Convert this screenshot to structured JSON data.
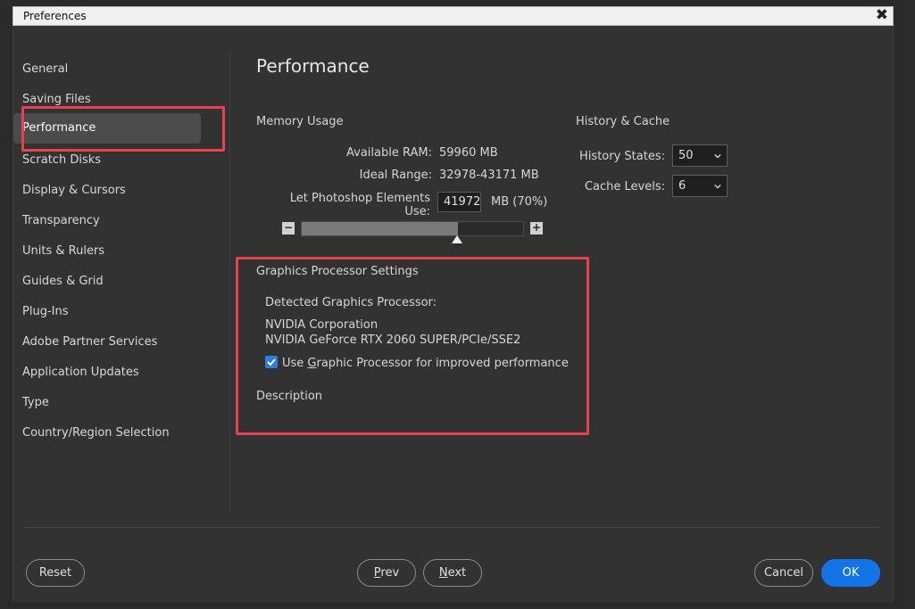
{
  "window": {
    "title": "Preferences",
    "close_glyph": "✖"
  },
  "sidebar": {
    "items": [
      {
        "label": "General"
      },
      {
        "label": "Saving Files"
      },
      {
        "label": "Performance"
      },
      {
        "label": "Scratch Disks"
      },
      {
        "label": "Display & Cursors"
      },
      {
        "label": "Transparency"
      },
      {
        "label": "Units & Rulers"
      },
      {
        "label": "Guides & Grid"
      },
      {
        "label": "Plug-Ins"
      },
      {
        "label": "Adobe Partner Services"
      },
      {
        "label": "Application Updates"
      },
      {
        "label": "Type"
      },
      {
        "label": "Country/Region Selection"
      }
    ],
    "selected": "Performance"
  },
  "main": {
    "title": "Performance",
    "memory": {
      "heading": "Memory Usage",
      "available_ram_label": "Available RAM:",
      "available_ram_value": "59960 MB",
      "ideal_range_label": "Ideal Range:",
      "ideal_range_value": "32978-43171 MB",
      "let_use_label": "Let Photoshop Elements Use:",
      "let_use_value": "41972",
      "let_use_suffix": "MB (70%)",
      "slider_fraction": 0.7,
      "minus_glyph": "−",
      "plus_glyph": "+"
    },
    "history": {
      "heading": "History & Cache",
      "history_states_label": "History States:",
      "history_states_value": "50",
      "cache_levels_label": "Cache Levels:",
      "cache_levels_value": "6"
    },
    "gpu": {
      "heading": "Graphics Processor Settings",
      "detected_label": "Detected Graphics Processor:",
      "vendor": "NVIDIA Corporation",
      "model": "NVIDIA GeForce RTX 2060 SUPER/PCIe/SSE2",
      "use_gpu_pre": "Use ",
      "use_gpu_mnemonic": "G",
      "use_gpu_post": "raphic Processor for improved performance",
      "use_gpu_checked": true,
      "description_label": "Description"
    }
  },
  "footer": {
    "reset_label": "Reset",
    "prev_mnemonic": "P",
    "prev_rest": "rev",
    "next_mnemonic": "N",
    "next_rest": "ext",
    "cancel_label": "Cancel",
    "ok_label": "OK"
  },
  "colors": {
    "accent": "#1473e6",
    "highlight_box": "#e5444f",
    "checkbox": "#2e7fd9"
  }
}
